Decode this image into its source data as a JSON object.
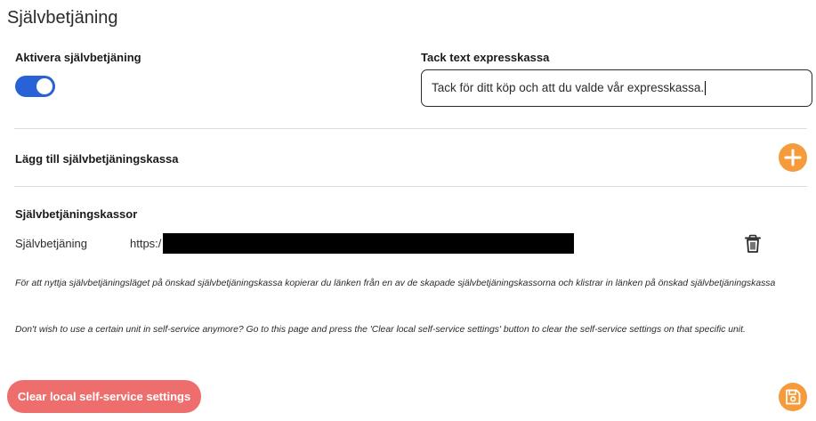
{
  "page": {
    "title": "Självbetjäning"
  },
  "activate": {
    "label": "Aktivera självbetjäning",
    "enabled": true,
    "accent_color": "#2962d6"
  },
  "thanks": {
    "label": "Tack text expresskassa",
    "value": "Tack för ditt köp och att du valde vår expresskassa."
  },
  "add_register": {
    "label": "Lägg till självbetjäningskassa",
    "icon": "plus-icon",
    "color": "#f59b3c"
  },
  "registers": {
    "heading": "Självbetjäningskassor",
    "items": [
      {
        "name": "Självbetjäning",
        "url_prefix": "https:/",
        "delete_icon": "trash-icon"
      }
    ]
  },
  "notes": {
    "sv": "För att nyttja självbetjäningsläget på önskad självbetjäningskassa kopierar du länken från en av de skapade självbetjäningskassorna och klistrar in länken på önskad självbetjäningskassa",
    "en": "Don't wish to use a certain unit in self-service anymore? Go to this page and press the 'Clear local self-service settings' button to clear the self-service settings on that specific unit."
  },
  "actions": {
    "clear_label": "Clear local self-service settings",
    "clear_color": "#ee6e6e",
    "save_icon": "save-icon"
  }
}
